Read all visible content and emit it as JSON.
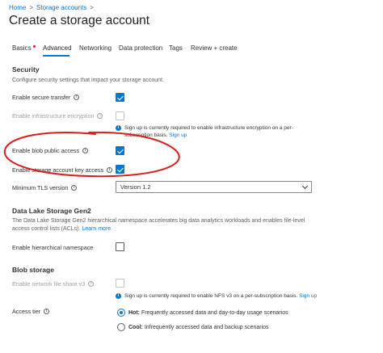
{
  "breadcrumb": {
    "home": "Home",
    "sep1": ">",
    "storage": "Storage accounts",
    "sep2": ">"
  },
  "title": "Create a storage account",
  "more": "···",
  "tabs": {
    "basics": "Basics",
    "advanced": "Advanced",
    "networking": "Networking",
    "data_protection": "Data protection",
    "tags": "Tags",
    "review": "Review + create"
  },
  "security": {
    "heading": "Security",
    "description": "Configure security settings that impact your storage account.",
    "secure_transfer": "Enable secure transfer",
    "infra_encryption": "Enable infrastructure encryption",
    "infra_notice": "Sign up is currently required to enable infrastructure encryption on a per-subscription basis.",
    "infra_notice_link": "Sign up",
    "blob_public_access": "Enable blob public access",
    "key_access": "Enable storage account key access",
    "tls_label": "Minimum TLS version",
    "tls_value": "Version 1.2"
  },
  "datalake": {
    "heading": "Data Lake Storage Gen2",
    "description": "The Data Lake Storage Gen2 hierarchical namespace accelerates big data analytics workloads and enables file-level access control lists (ACLs).",
    "learn_more": "Learn more",
    "hns": "Enable hierarchical namespace"
  },
  "blob": {
    "heading": "Blob storage",
    "nfs": "Enable network file share v3",
    "nfs_notice": "Sign up is currently required to enable NFS v3 on a per-subscription basis.",
    "nfs_notice_link": "Sign up",
    "access_tier": "Access tier",
    "hot_label": "Hot:",
    "hot_desc": "Frequently accessed data and day-to-day usage scenarios",
    "cool_label": "Cool:",
    "cool_desc": "Infrequently accessed data and backup scenarios"
  },
  "colors": {
    "accent": "#0078d4",
    "annotation": "#d6201b",
    "required_dot": "#e81123"
  }
}
